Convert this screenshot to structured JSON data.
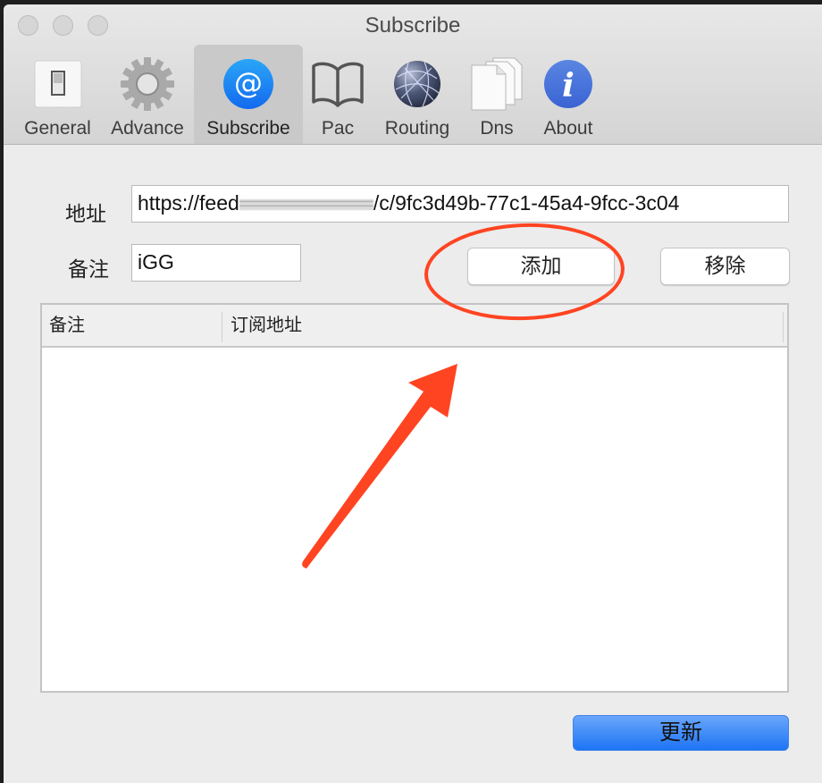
{
  "window": {
    "title": "Subscribe"
  },
  "toolbar": {
    "items": [
      {
        "label": "General",
        "icon": "switch-icon"
      },
      {
        "label": "Advance",
        "icon": "gear-icon"
      },
      {
        "label": "Subscribe",
        "icon": "at-icon",
        "active": true
      },
      {
        "label": "Pac",
        "icon": "book-icon"
      },
      {
        "label": "Routing",
        "icon": "globe-icon"
      },
      {
        "label": "Dns",
        "icon": "documents-icon"
      },
      {
        "label": "About",
        "icon": "info-icon"
      }
    ]
  },
  "form": {
    "address_label": "地址",
    "address_prefix": "https://feed",
    "address_suffix": "/c/9fc3d49b-77c1-45a4-9fcc-3c04",
    "remark_label": "备注",
    "remark_value": "iGG",
    "add_button": "添加",
    "remove_button": "移除"
  },
  "table": {
    "columns": [
      "备注",
      "订阅地址"
    ],
    "rows": []
  },
  "footer": {
    "update_button": "更新"
  },
  "annotation": {
    "color": "#ff4422"
  }
}
